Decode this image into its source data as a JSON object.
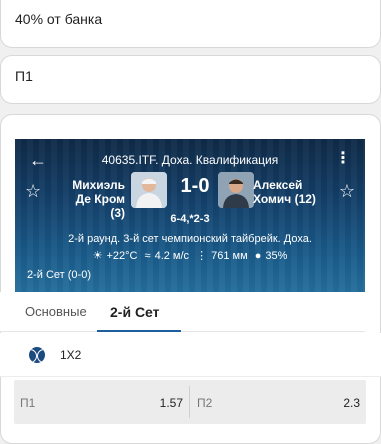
{
  "cards": {
    "bet_amount": "40% от банка",
    "selection": "П1"
  },
  "match": {
    "tournament": "40635.ITF. Доха. Квалификация",
    "player1": "Михиэль Де Кром (3)",
    "player2": "Алексей Хомич (12)",
    "score": "1-0",
    "sets": "6-4,*2-3",
    "round": "2-й раунд. 3-й сет чемпионский тайбрейк. Доха.",
    "temperature": "+22°C",
    "wind": "4.2 м/с",
    "pressure": "761 мм",
    "humidity": "35%",
    "set_info": "2-й Сет (0-0)"
  },
  "tabs": [
    {
      "label": "Основные",
      "active": false
    },
    {
      "label": "2-й Сет",
      "active": true
    }
  ],
  "market": {
    "name": "1Х2",
    "icon": "tennis-ball-icon",
    "odds": [
      {
        "label": "П1",
        "value": "1.57"
      },
      {
        "label": "П2",
        "value": "2.3"
      }
    ]
  },
  "colors": {
    "accent": "#1f5fa0",
    "header_bg": "#14406a",
    "odds_bg": "#ececec"
  }
}
